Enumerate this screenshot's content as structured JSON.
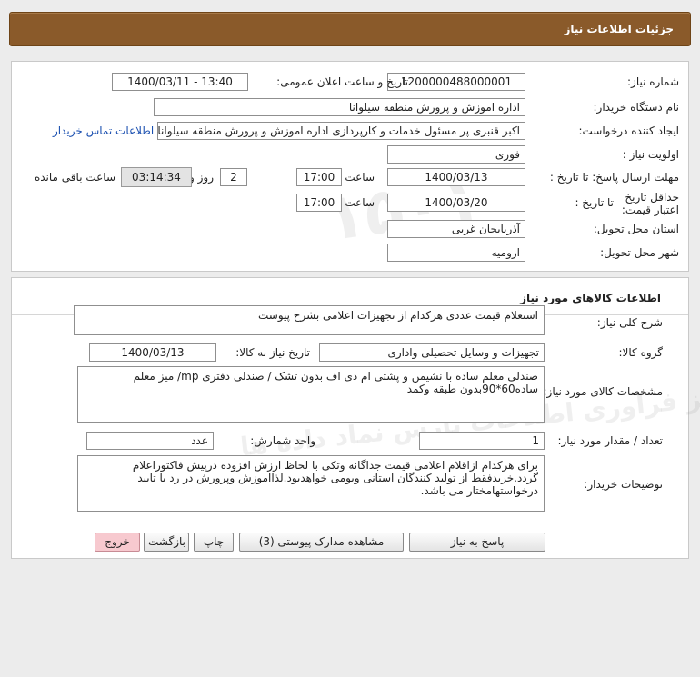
{
  "header": {
    "title": "جزئیات اطلاعات نیاز"
  },
  "info": {
    "need_number_label": "شماره نیاز:",
    "need_number": "1200000488000001",
    "announce_label": "تاریخ و ساعت اعلان عمومی:",
    "announce_value": "1400/03/11 - 13:40",
    "buyer_org_label": "نام دستگاه خریدار:",
    "buyer_org": "اداره اموزش و پرورش منطقه سیلوانا",
    "creator_label": "ایجاد کننده درخواست:",
    "creator": "اکبر قنبری پر مسئول خدمات و کارپردازی اداره اموزش و پرورش منطقه سیلوانا",
    "contact_link": "اطلاعات تماس خریدار",
    "priority_label": "اولویت نیاز :",
    "priority": "فوری",
    "deadline_label": "مهلت ارسال پاسخ: تا تاریخ :",
    "deadline_date": "1400/03/13",
    "time_label": "ساعت",
    "deadline_time": "17:00",
    "days_value": "2",
    "days_label": "روز و",
    "remaining_time": "03:14:34",
    "remaining_label": "ساعت باقی مانده",
    "validity_label": "حداقل تاریخ اعتبار قیمت:",
    "validity_to_label": "تا تاریخ :",
    "validity_date": "1400/03/20",
    "validity_time_label": "ساعت",
    "validity_time": "17:00",
    "province_label": "استان محل تحویل:",
    "province": "آذربایجان غربی",
    "city_label": "شهر محل تحویل:",
    "city": "ارومیه"
  },
  "goods": {
    "section_title": "اطلاعات کالاهای مورد نیاز",
    "summary_label": "شرح کلی نیاز:",
    "summary": "استعلام قیمت عددی هرکدام از تجهیزات اعلامی بشرح پیوست",
    "group_label": "گروه کالا:",
    "group": "تجهیزات و وسایل تحصیلی واداری",
    "need_date_label": "تاریخ نیاز به کالا:",
    "need_date": "1400/03/13",
    "specs_label": "مشخصات کالای مورد نیاز:",
    "specs": "صندلی معلم ساده با نشیمن و پشتی ام دی اف بدون تشک / صندلی دفتری mp/ میز معلم ساده60*90بدون طبقه وکمد",
    "qty_label": "تعداد / مقدار مورد نیاز:",
    "qty": "1",
    "unit_label": "واحد شمارش:",
    "unit": "عدد",
    "buyer_notes_label": "توضیحات خریدار:",
    "buyer_notes": "برای هرکدام ازاقلام اعلامی قیمت جداگانه وتکی با لحاظ ارزش افزوده درپیش فاکتوراعلام گردد.خریدفقط از تولید کنندگان استانی وبومی خواهدبود.لذااموزش وپرورش در رد یا تایید درخواستهامختار می باشد."
  },
  "buttons": {
    "reply": "پاسخ به نیاز",
    "attachments": "مشاهده مدارک پیوستی (3)",
    "print": "چاپ",
    "back": "بازگشت",
    "exit": "خروج"
  }
}
